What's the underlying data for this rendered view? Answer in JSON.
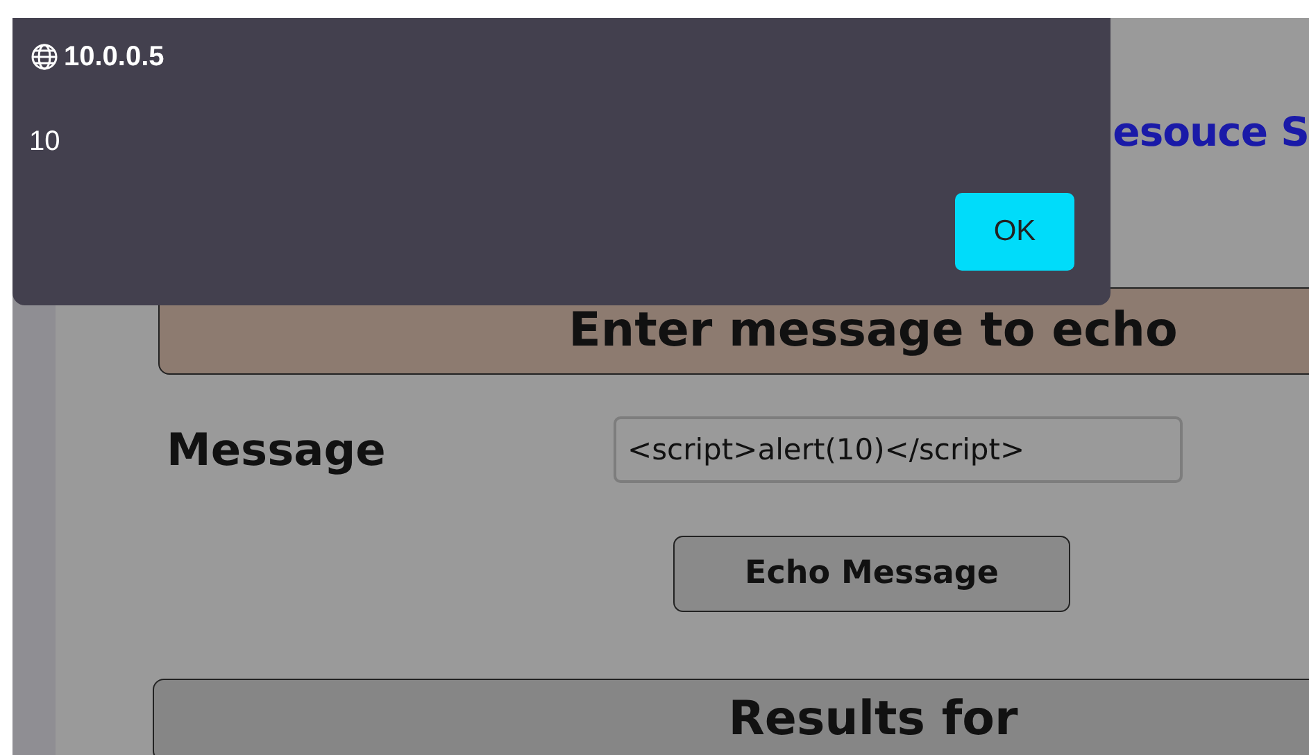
{
  "alert": {
    "origin": "10.0.0.5",
    "message": "10",
    "button": "OK"
  },
  "page": {
    "title": "esouce S",
    "form_header": "Enter message to echo",
    "message_label": "Message",
    "message_field": {
      "value": "<script>alert(10)</script>"
    },
    "submit_button": "Echo Message",
    "results_header": "Results for"
  }
}
